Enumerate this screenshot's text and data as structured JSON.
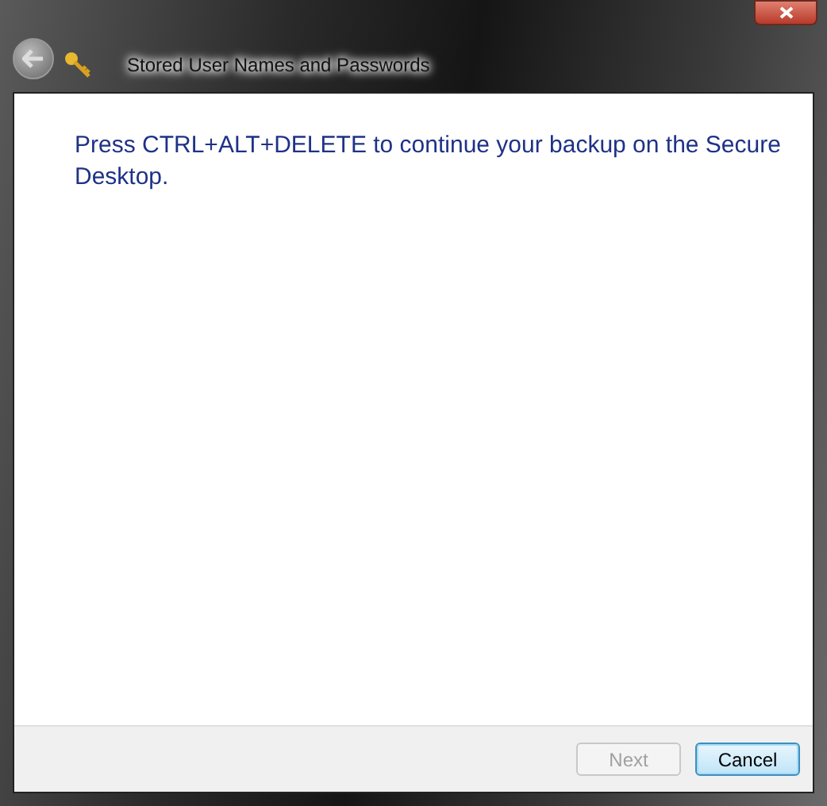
{
  "window": {
    "title": "Stored User Names and Passwords"
  },
  "message": "Press CTRL+ALT+DELETE to continue your backup on the Secure Desktop.",
  "buttons": [
    {
      "label": "Next",
      "disabled": true,
      "default": false
    },
    {
      "label": "Cancel",
      "disabled": false,
      "default": true
    }
  ]
}
